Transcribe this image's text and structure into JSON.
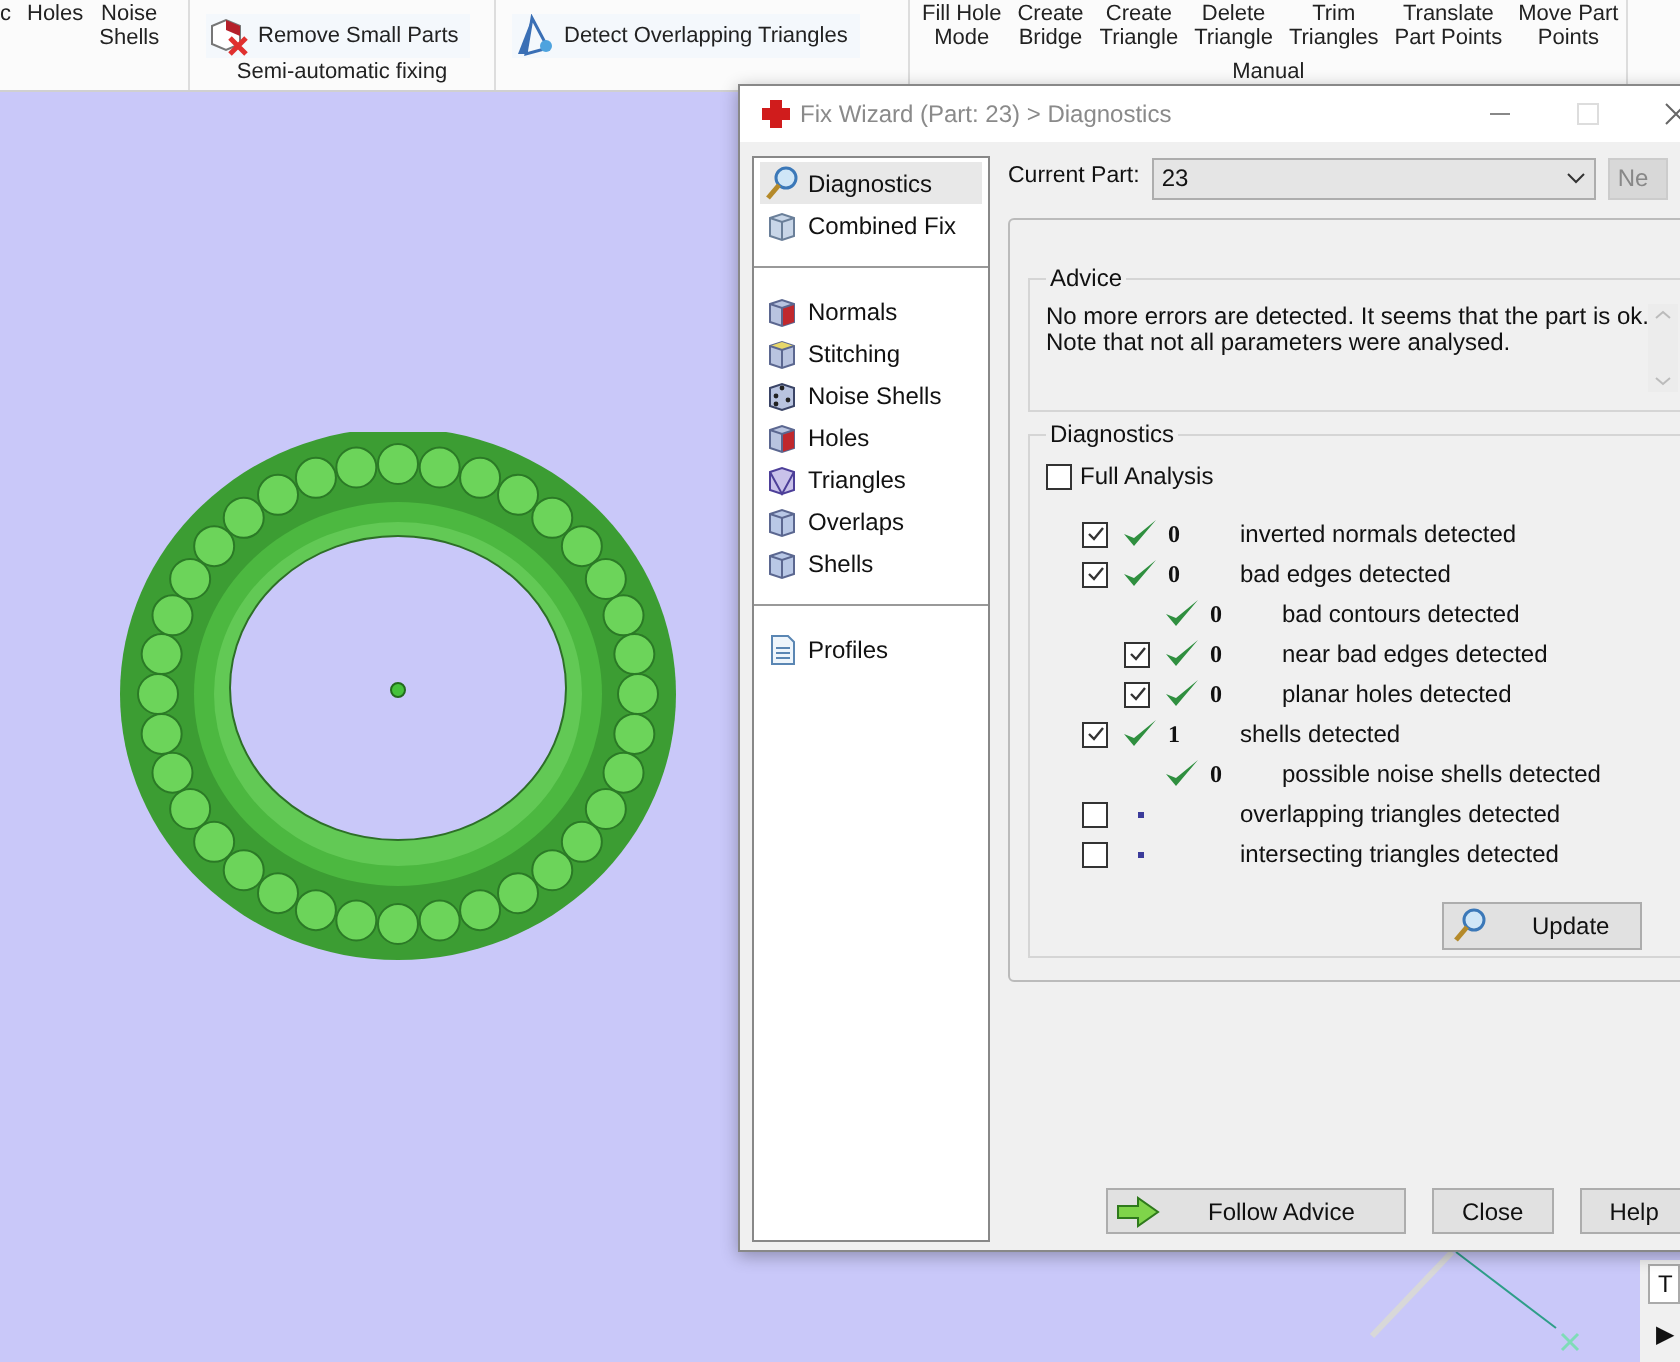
{
  "ribbon": {
    "groups": [
      {
        "items": [
          {
            "lines": [
              "c"
            ]
          },
          {
            "lines": [
              "Holes"
            ]
          },
          {
            "lines": [
              "Noise",
              "Shells"
            ]
          }
        ]
      },
      {
        "label": "Semi-automatic fixing",
        "wide": [
          {
            "text": "Remove Small Parts"
          }
        ]
      },
      {
        "wide": [
          {
            "text": "Detect Overlapping Triangles"
          }
        ]
      },
      {
        "label": "Manual",
        "items": [
          {
            "lines": [
              "Fill Hole",
              "Mode"
            ]
          },
          {
            "lines": [
              "Create",
              "Bridge"
            ]
          },
          {
            "lines": [
              "Create",
              "Triangle"
            ]
          },
          {
            "lines": [
              "Delete",
              "Triangle"
            ]
          },
          {
            "lines": [
              "Trim",
              "Triangles"
            ]
          },
          {
            "lines": [
              "Translate",
              "Part Points"
            ]
          },
          {
            "lines": [
              "Move Part",
              "Points"
            ]
          }
        ]
      }
    ]
  },
  "dialog": {
    "title": "Fix Wizard (Part: 23) > Diagnostics",
    "nav": [
      [
        {
          "label": "Diagnostics",
          "selected": true
        },
        {
          "label": "Combined Fix",
          "selected": false
        }
      ],
      [
        {
          "label": "Normals",
          "selected": false
        },
        {
          "label": "Stitching",
          "selected": false
        },
        {
          "label": "Noise Shells",
          "selected": false
        },
        {
          "label": "Holes",
          "selected": false
        },
        {
          "label": "Triangles",
          "selected": false
        },
        {
          "label": "Overlaps",
          "selected": false
        },
        {
          "label": "Shells",
          "selected": false
        }
      ],
      [
        {
          "label": "Profiles",
          "selected": false
        }
      ]
    ],
    "current_part": {
      "label": "Current Part:",
      "value": "23"
    },
    "next_button": "Ne",
    "advice": {
      "title": "Advice",
      "text": "No more errors are detected. It seems that the part is ok.\nNote that not all parameters were analysed."
    },
    "diagnostics": {
      "title": "Diagnostics",
      "full_analysis": {
        "label": "Full Analysis",
        "checked": false
      },
      "rows": [
        {
          "checked": true,
          "kind": "ok",
          "count": "0",
          "label": "inverted normals detected"
        },
        {
          "checked": true,
          "kind": "ok",
          "count": "0",
          "label": "bad edges detected",
          "children": [
            {
              "kind": "ok",
              "count": "0",
              "label": "bad contours detected"
            },
            {
              "checked": true,
              "kind": "ok",
              "count": "0",
              "label": "near bad edges detected"
            },
            {
              "checked": true,
              "kind": "ok",
              "count": "0",
              "label": "planar holes detected"
            }
          ]
        },
        {
          "checked": true,
          "kind": "ok",
          "count": "1",
          "label": "shells detected",
          "children": [
            {
              "kind": "ok",
              "count": "0",
              "label": "possible noise shells detected"
            }
          ]
        },
        {
          "checked": false,
          "kind": "pending",
          "label": "overlapping triangles detected"
        },
        {
          "checked": false,
          "kind": "pending",
          "label": "intersecting triangles detected"
        }
      ],
      "update_button": "Update"
    },
    "buttons": [
      {
        "kind": "follow",
        "label": "Follow Advice"
      },
      {
        "kind": "plain",
        "label": "Close"
      },
      {
        "kind": "plain",
        "label": "Help"
      }
    ]
  },
  "side_panel": {
    "tab": "T",
    "arrow": "▶"
  }
}
